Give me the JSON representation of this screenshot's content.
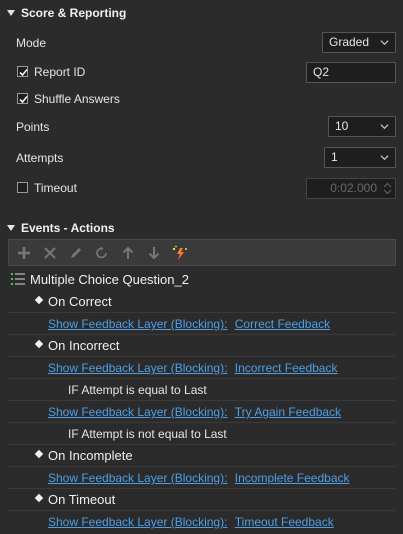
{
  "score_section": {
    "title": "Score & Reporting",
    "mode": {
      "label": "Mode",
      "value": "Graded"
    },
    "report_id": {
      "label": "Report ID",
      "checked": true,
      "value": "Q2"
    },
    "shuffle": {
      "label": "Shuffle Answers",
      "checked": true
    },
    "points": {
      "label": "Points",
      "value": "10"
    },
    "attempts": {
      "label": "Attempts",
      "value": "1"
    },
    "timeout": {
      "label": "Timeout",
      "checked": false,
      "value": "0:02.000"
    }
  },
  "events_section": {
    "title": "Events - Actions",
    "toolbar": [
      "add-icon",
      "delete-icon",
      "edit-icon",
      "refresh-icon",
      "move-up-icon",
      "move-down-icon",
      "magic-icon"
    ],
    "object_name": "Multiple Choice Question_2",
    "events": [
      {
        "name": "On Correct",
        "actions": [
          {
            "type": "Show Feedback Layer (Blocking):",
            "target": "Correct Feedback"
          }
        ]
      },
      {
        "name": "On Incorrect",
        "actions": [
          {
            "cond": "IF Attempt is equal to Last"
          },
          {
            "type": "Show Feedback Layer (Blocking):",
            "target": "Incorrect Feedback"
          },
          {
            "cond": "IF Attempt is not equal to Last"
          },
          {
            "type": "Show Feedback Layer (Blocking):",
            "target": "Try Again Feedback"
          }
        ]
      },
      {
        "name": "On Incomplete",
        "actions": [
          {
            "type": "Show Feedback Layer (Blocking):",
            "target": "Incomplete Feedback"
          }
        ]
      },
      {
        "name": "On Timeout",
        "actions": [
          {
            "type": "Show Feedback Layer (Blocking):",
            "target": "Timeout Feedback"
          }
        ]
      }
    ]
  },
  "colors": {
    "background": "#2b2b2b",
    "link": "#4e9fe6",
    "field": "#1e1e1e"
  }
}
